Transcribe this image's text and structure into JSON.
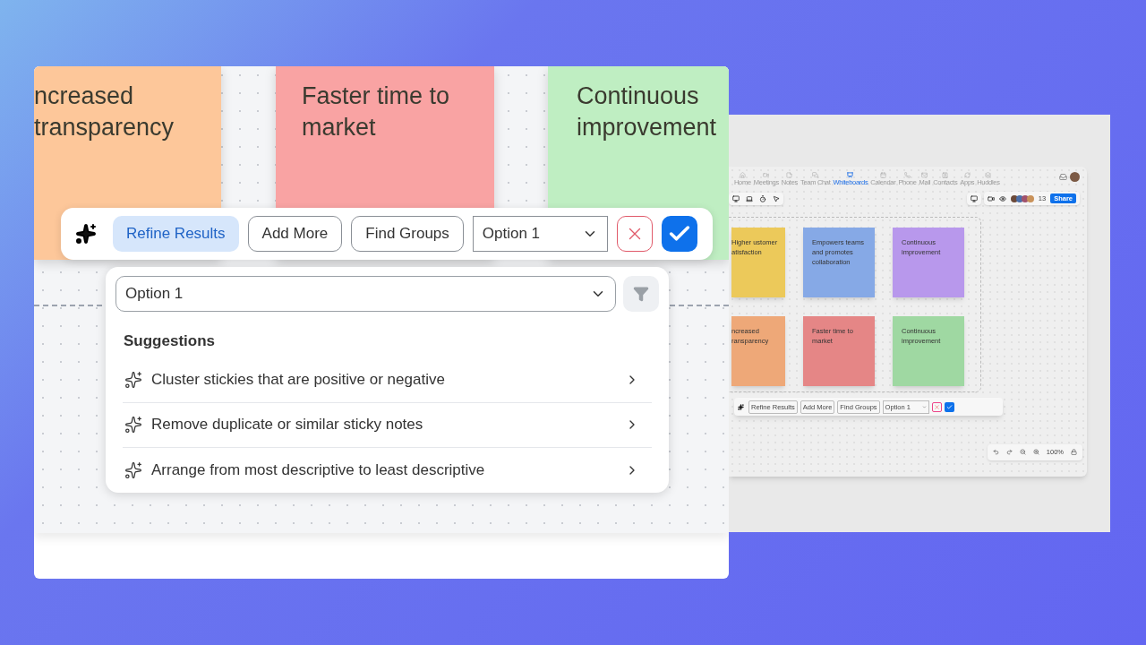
{
  "main_view": {
    "stickies": [
      {
        "text": "ncreased transparency",
        "color": "#fdc79a"
      },
      {
        "text": "Faster time to market",
        "color": "#f9a3a3"
      },
      {
        "text": "Continuous improvement",
        "color": "#bfeec2"
      }
    ],
    "toolbar": {
      "buttons": [
        {
          "label": "Refine Results",
          "selected": true
        },
        {
          "label": "Add More",
          "selected": false
        },
        {
          "label": "Find Groups",
          "selected": false
        }
      ],
      "dropdown": "Option 1"
    },
    "panel": {
      "dropdown": "Option 1",
      "heading": "Suggestions",
      "suggestions": [
        "Cluster stickies that are positive or negative",
        "Remove duplicate or similar sticky notes",
        "Arrange from most descriptive to least descriptive"
      ]
    }
  },
  "preview": {
    "nav": [
      {
        "label": "Home",
        "selected": false
      },
      {
        "label": "Meetings",
        "selected": false
      },
      {
        "label": "Notes",
        "selected": false
      },
      {
        "label": "Team Chat",
        "selected": false
      },
      {
        "label": "Whiteboards",
        "selected": true
      },
      {
        "label": "Calendar",
        "selected": false
      },
      {
        "label": "Phone",
        "selected": false
      },
      {
        "label": "Mail",
        "selected": false
      },
      {
        "label": "Contacts",
        "selected": false
      },
      {
        "label": "Apps",
        "selected": false
      },
      {
        "label": "Huddles",
        "selected": false
      }
    ],
    "participant_count": "13",
    "share": "Share",
    "stickies": [
      {
        "text": "Higher ustomer atisfaction",
        "color": "#ecc95a"
      },
      {
        "text": "Empowers teams and promotes collaboration",
        "color": "#86a9e6"
      },
      {
        "text": "Continuous improvement",
        "color": "#b898ec"
      },
      {
        "text": "ncreased ransparency",
        "color": "#eea878"
      },
      {
        "text": "Faster time to market",
        "color": "#e58686"
      },
      {
        "text": "Continuous improvement",
        "color": "#9fd8a2"
      }
    ],
    "toolbar": {
      "buttons": [
        "Refine Results",
        "Add More",
        "Find Groups"
      ],
      "dropdown": "Option 1"
    },
    "zoom": "100%"
  }
}
